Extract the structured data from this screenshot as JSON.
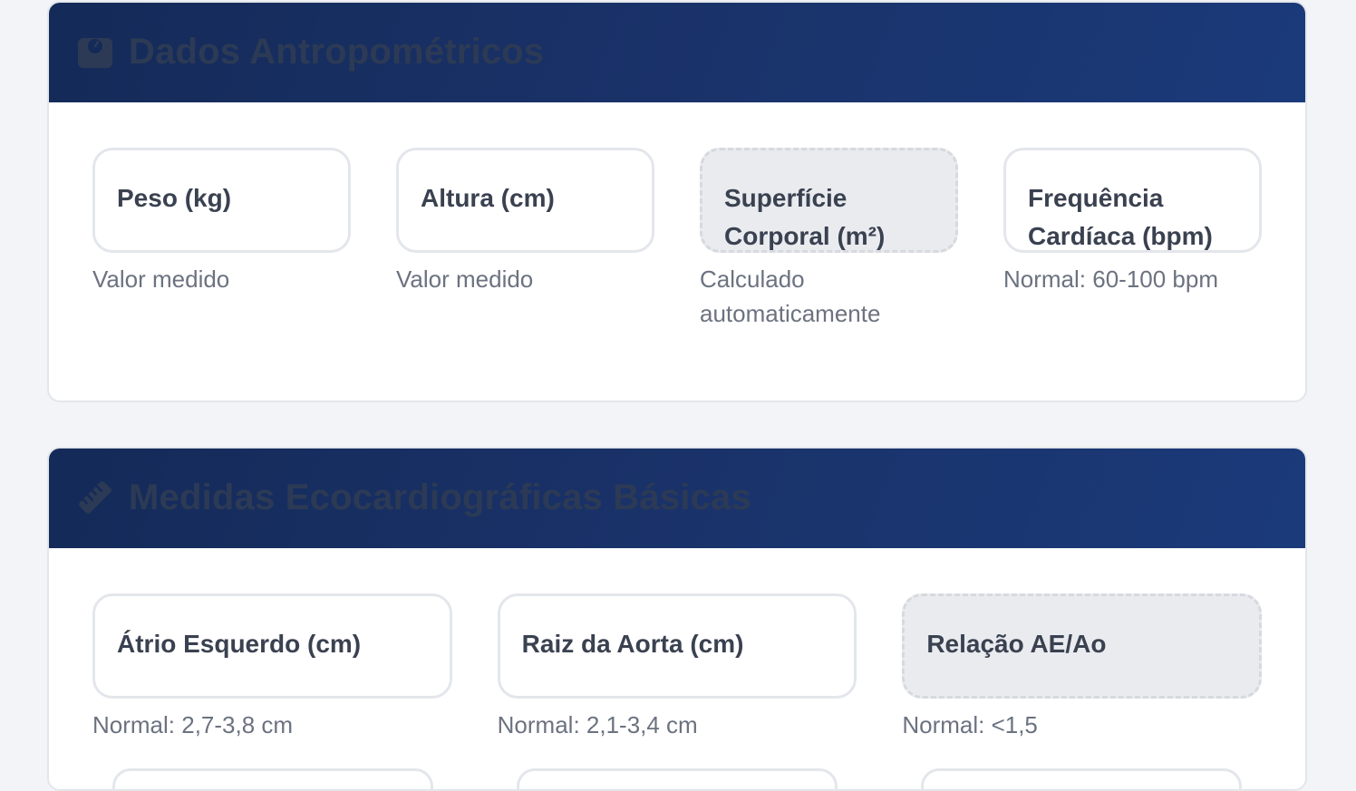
{
  "sections": [
    {
      "title": "Dados Antropométricos",
      "icon": "weight-scale-icon",
      "fields": [
        {
          "label": "Peso (kg)",
          "hint": "Valor medido",
          "calculated": false
        },
        {
          "label": "Altura (cm)",
          "hint": "Valor medido",
          "calculated": false
        },
        {
          "label": "Superfície Corporal (m²)",
          "hint": "Calculado automaticamente",
          "calculated": true
        },
        {
          "label": "Frequência Cardíaca (bpm)",
          "hint": "Normal: 60-100 bpm",
          "calculated": false
        }
      ]
    },
    {
      "title": "Medidas Ecocardiográficas Básicas",
      "icon": "ruler-icon",
      "fields": [
        {
          "label": "Átrio Esquerdo (cm)",
          "hint": "Normal: 2,7-3,8 cm",
          "calculated": false
        },
        {
          "label": "Raiz da Aorta (cm)",
          "hint": "Normal: 2,1-3,4 cm",
          "calculated": false
        },
        {
          "label": "Relação AE/Ao",
          "hint": "Normal: <1,5",
          "calculated": true
        }
      ]
    }
  ],
  "colors": {
    "header_start": "#142a58",
    "header_end": "#1b3a7a",
    "title_text": "#2c3a55",
    "page_bg": "#f2f4f7"
  }
}
